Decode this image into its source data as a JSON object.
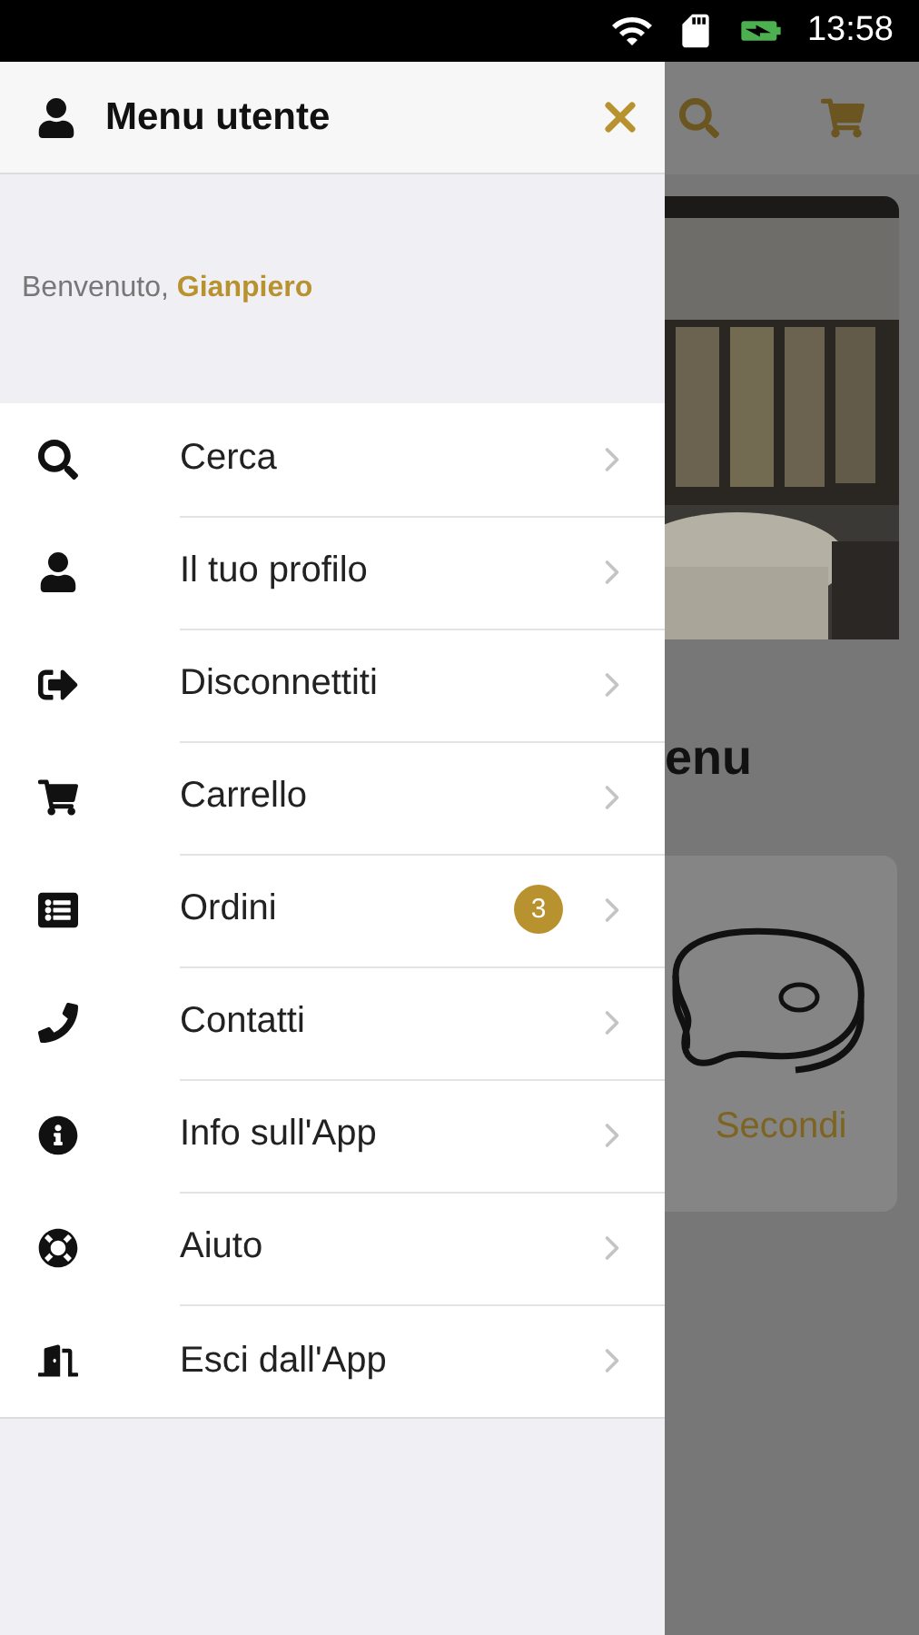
{
  "status_bar": {
    "time": "13:58"
  },
  "drawer": {
    "title": "Menu utente",
    "welcome": "Benvenuto, **Gianpiero**",
    "items": [
      {
        "label": "Cerca"
      },
      {
        "label": "Il tuo profilo"
      },
      {
        "label": "Disconnettiti"
      },
      {
        "label": "Carrello"
      },
      {
        "label": "Ordini",
        "badge": "3"
      },
      {
        "label": "Contatti"
      },
      {
        "label": "Info sull'App"
      },
      {
        "label": "Aiuto"
      },
      {
        "label": "Esci dall'App"
      }
    ]
  },
  "background": {
    "heading": "enu",
    "category": "Secondi"
  }
}
